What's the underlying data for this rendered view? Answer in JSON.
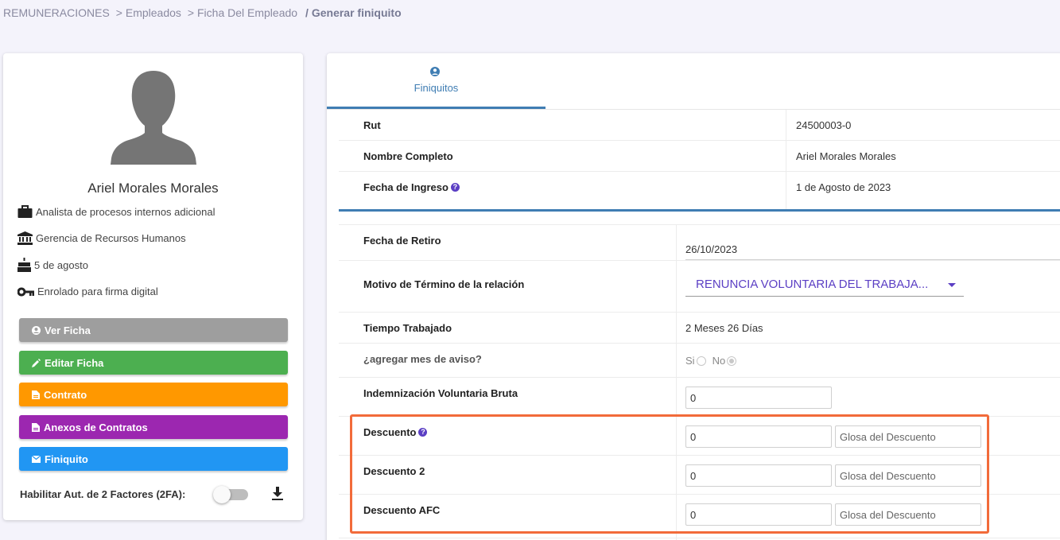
{
  "breadcrumb": {
    "items": [
      "REMUNERACIONES",
      "Empleados",
      "Ficha Del Empleado"
    ],
    "separator": ">",
    "current": "Generar finiquito"
  },
  "profile": {
    "name": "Ariel Morales Morales",
    "avatar_icon": "user-silhouette-icon",
    "position": "Analista de procesos internos adicional",
    "department": "Gerencia de Recursos Humanos",
    "birthday": "5 de agosto",
    "signature_status": "Enrolado para firma digital"
  },
  "actions": [
    {
      "label": "Ver Ficha",
      "icon": "user-circle-icon",
      "color": "#9e9e9e"
    },
    {
      "label": "Editar Ficha",
      "icon": "pencil-icon",
      "color": "#4caf50"
    },
    {
      "label": "Contrato",
      "icon": "document-icon",
      "color": "#ff9800"
    },
    {
      "label": "Anexos de Contratos",
      "icon": "document-icon",
      "color": "#9c27b0"
    },
    {
      "label": "Finiquito",
      "icon": "envelope-icon",
      "color": "#2196f3"
    }
  ],
  "twofa": {
    "label": "Habilitar Aut. de 2 Factores (2FA):",
    "enabled": false
  },
  "tabs": [
    {
      "label": "Finiquitos",
      "icon": "user-circle-icon",
      "active": true
    }
  ],
  "employee_info": {
    "rut_label": "Rut",
    "rut": "24500003-0",
    "name_label": "Nombre Completo",
    "name": "Ariel Morales Morales",
    "start_label": "Fecha de Ingreso",
    "start": "1 de Agosto de 2023"
  },
  "form": {
    "retiro_label": "Fecha de Retiro",
    "retiro_value": "26/10/2023",
    "motivo_label": "Motivo de Término de la relación",
    "motivo_value": "RENUNCIA VOLUNTARIA DEL TRABAJA...",
    "tiempo_label": "Tiempo Trabajado",
    "tiempo_value": "2 Meses 26 Días",
    "aviso_label": "¿agregar mes de aviso?",
    "aviso_si": "Si",
    "aviso_no": "No",
    "aviso_selected": "No",
    "indemnizacion_label": "Indemnización Voluntaria Bruta",
    "indemnizacion_value": "0",
    "descuento_label": "Descuento",
    "descuento_value": "0",
    "descuento_glosa_placeholder": "Glosa del Descuento",
    "descuento2_label": "Descuento 2",
    "descuento2_value": "0",
    "descuento2_glosa_placeholder": "Glosa del Descuento",
    "descuento_afc_label": "Descuento AFC",
    "descuento_afc_value": "0",
    "descuento_afc_glosa_placeholder": "Glosa del Descuento"
  },
  "colors": {
    "accent_blue": "#3f7db3",
    "accent_purple": "#5b3fc4",
    "highlight": "#f26b3a"
  }
}
